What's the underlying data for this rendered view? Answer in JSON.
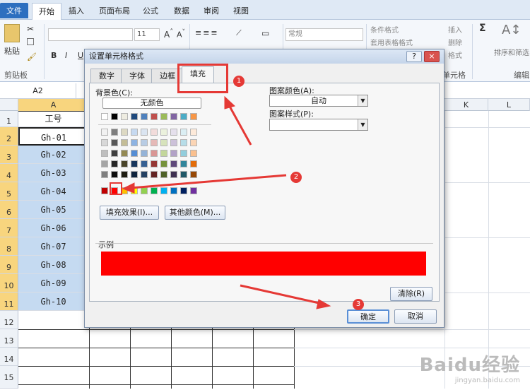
{
  "ribbon": {
    "tabs": [
      "文件",
      "开始",
      "插入",
      "页面布局",
      "公式",
      "数据",
      "审阅",
      "视图"
    ],
    "paste_label": "粘贴",
    "clipboard_label": "剪贴板",
    "font_size": "11",
    "number_format": "常规",
    "cond_format": "条件格式",
    "table_format": "套用表格格式",
    "insert": "插入",
    "delete": "删除",
    "format": "格式",
    "cells_label": "单元格",
    "sort_filter": "排序和筛选",
    "edit_label": "编辑"
  },
  "namebox": "A2",
  "grid": {
    "columns": [
      "A",
      "K",
      "L"
    ],
    "rows": [
      "1",
      "2",
      "3",
      "4",
      "5",
      "6",
      "7",
      "8",
      "9",
      "10",
      "11",
      "12",
      "13",
      "14",
      "15"
    ],
    "header_cell": "工号",
    "cells": [
      "Gh-01",
      "Gh-02",
      "Gh-03",
      "Gh-04",
      "Gh-05",
      "Gh-06",
      "Gh-07",
      "Gh-08",
      "Gh-09",
      "Gh-10"
    ]
  },
  "dialog": {
    "title": "设置单元格格式",
    "help": "?",
    "close": "×",
    "tabs": [
      "数字",
      "字体",
      "边框",
      "填充"
    ],
    "bg_color_label": "背景色(C):",
    "no_color": "无颜色",
    "fill_effects": "填充效果(I)...",
    "more_colors": "其他颜色(M)...",
    "pattern_color_label": "图案颜色(A):",
    "pattern_color_value": "自动",
    "pattern_style_label": "图案样式(P):",
    "sample_label": "示例",
    "sample_color": "#ff0000",
    "clear": "清除(R)",
    "ok": "确定",
    "cancel": "取消"
  },
  "palette": {
    "row1": [
      "#ffffff",
      "#000000",
      "#eeece1",
      "#1f497d",
      "#4f81bd",
      "#c0504d",
      "#9bbb59",
      "#8064a2",
      "#4bacc6",
      "#f79646"
    ],
    "rows": [
      [
        "#f2f2f2",
        "#7f7f7f",
        "#ddd9c3",
        "#c6d9f0",
        "#dbe5f1",
        "#f2dcdb",
        "#ebf1dd",
        "#e5e0ec",
        "#dbeef3",
        "#fdeada"
      ],
      [
        "#d8d8d8",
        "#595959",
        "#c4bd97",
        "#8db3e2",
        "#b8cce4",
        "#e5b9b7",
        "#d7e3bc",
        "#ccc1d9",
        "#b7dde8",
        "#fbd5b5"
      ],
      [
        "#bfbfbf",
        "#3f3f3f",
        "#938953",
        "#548dd4",
        "#95b3d7",
        "#d99694",
        "#c3d69b",
        "#b2a2c7",
        "#92cddc",
        "#fac08f"
      ],
      [
        "#a5a5a5",
        "#262626",
        "#494429",
        "#17365d",
        "#366092",
        "#953734",
        "#76923c",
        "#5f497a",
        "#31859b",
        "#e36c09"
      ],
      [
        "#7f7f7f",
        "#0c0c0c",
        "#1d1b10",
        "#0f243e",
        "#244061",
        "#632423",
        "#4f6128",
        "#3f3151",
        "#205867",
        "#974806"
      ]
    ],
    "standard": [
      "#c00000",
      "#ff0000",
      "#ffc000",
      "#ffff00",
      "#92d050",
      "#00b050",
      "#00b0f0",
      "#0070c0",
      "#002060",
      "#7030a0"
    ]
  },
  "annotations": {
    "b1": "1",
    "b2": "2",
    "b3": "3",
    "color": "#e53935"
  },
  "watermark": {
    "brand": "Baidu经验",
    "url": "jingyan.baidu.com"
  }
}
